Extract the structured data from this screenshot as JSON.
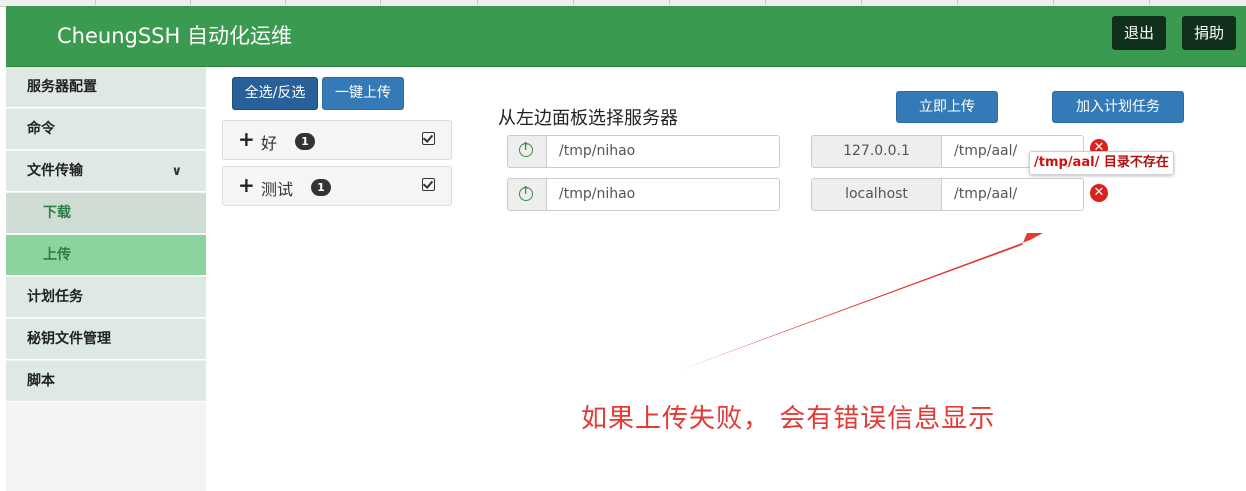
{
  "app": {
    "brand": "CheungSSH 自动化运维",
    "nav": {
      "logout": "退出",
      "donate": "捐助"
    }
  },
  "sidebar": {
    "items": [
      {
        "label": "服务器配置"
      },
      {
        "label": "命令"
      },
      {
        "label": "文件传输",
        "expanded": true
      },
      {
        "label": "下载",
        "sub": true
      },
      {
        "label": "上传",
        "sub": true,
        "active": true
      },
      {
        "label": "计划任务"
      },
      {
        "label": "秘钥文件管理"
      },
      {
        "label": "脚本"
      }
    ]
  },
  "toolbar": {
    "select_all": "全选/反选",
    "one_click_upload": "一键上传"
  },
  "groups": [
    {
      "name": "好",
      "count": "1"
    },
    {
      "name": "测试",
      "count": "1"
    }
  ],
  "main": {
    "heading": "从左边面板选择服务器",
    "upload_now": "立即上传",
    "add_task": "加入计划任务"
  },
  "rows": [
    {
      "local_path": "/tmp/nihao",
      "host": "127.0.0.1",
      "remote_path": "/tmp/aal/"
    },
    {
      "local_path": "/tmp/nihao",
      "host": "localhost",
      "remote_path": "/tmp/aal/"
    }
  ],
  "error_tooltip": {
    "path": "/tmp/aal/",
    "message": "目录不存在"
  },
  "annotation": "如果上传失败， 会有错误信息显示",
  "colors": {
    "navbar": "#3a9a4f",
    "primary_button": "#337ab7",
    "error": "#d9221b",
    "annotation": "#e53935"
  }
}
